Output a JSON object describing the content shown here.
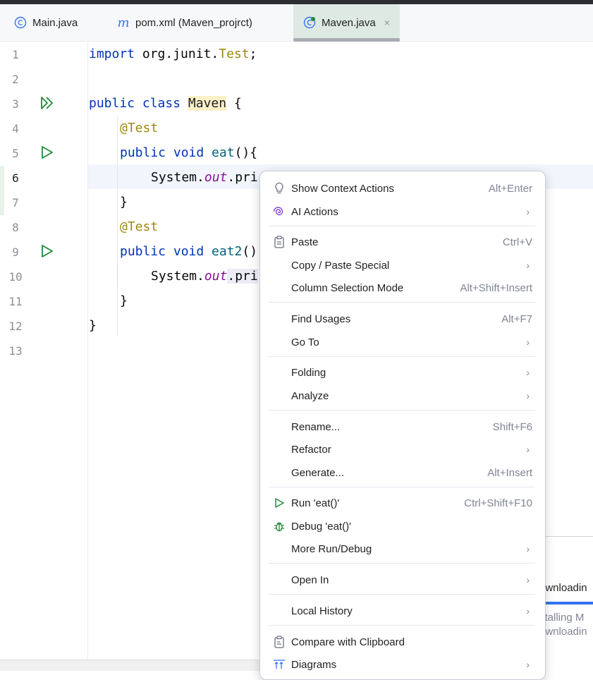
{
  "tabs": [
    {
      "label": "Main.java",
      "icon": "java-class-icon"
    },
    {
      "label": "pom.xml (Maven_projrct)",
      "icon": "maven-icon"
    },
    {
      "label": "Maven.java",
      "icon": "java-test-class-icon",
      "close": "×"
    }
  ],
  "editor": {
    "line_numbers": [
      "1",
      "2",
      "3",
      "4",
      "5",
      "6",
      "7",
      "8",
      "9",
      "10",
      "11",
      "12",
      "13"
    ],
    "code": {
      "l1_kw": "import",
      "l1_pkg": " org.junit.",
      "l1_cls": "Test",
      "l1_end": ";",
      "l3_kw": "public class ",
      "l3_cls": "Maven",
      "l3_end": " {",
      "l4_ann": "@Test",
      "l5_kw": "public void ",
      "l5_m": "eat",
      "l5_end": "(){",
      "l6_a": "System.",
      "l6_f": "out",
      "l6_b": ".pri",
      "l7": "}",
      "l8_ann": "@Test",
      "l9_kw": "public void ",
      "l9_m": "eat2",
      "l9_end": "()",
      "l10_a": "System.",
      "l10_f": "out",
      "l10_b": ".pri",
      "l11": "}",
      "l12": "}"
    }
  },
  "background_popup": {
    "line1": "ownloadin",
    "line2": "stalling M",
    "line3": "ownloadin"
  },
  "context_menu": {
    "items": [
      {
        "label": "Show Context Actions",
        "shortcut": "Alt+Enter",
        "icon": "lightbulb-icon"
      },
      {
        "label": "AI Actions",
        "submenu": "›",
        "icon": "ai-spiral-icon"
      },
      {
        "label": "Paste",
        "shortcut": "Ctrl+V",
        "icon": "clipboard-icon"
      },
      {
        "label": "Copy / Paste Special",
        "submenu": "›"
      },
      {
        "label": "Column Selection Mode",
        "shortcut": "Alt+Shift+Insert"
      },
      {
        "label": "Find Usages",
        "shortcut": "Alt+F7"
      },
      {
        "label": "Go To",
        "submenu": "›"
      },
      {
        "label": "Folding",
        "submenu": "›"
      },
      {
        "label": "Analyze",
        "submenu": "›"
      },
      {
        "label": "Rename...",
        "shortcut": "Shift+F6"
      },
      {
        "label": "Refactor",
        "submenu": "›"
      },
      {
        "label": "Generate...",
        "shortcut": "Alt+Insert"
      },
      {
        "label": "Run 'eat()'",
        "shortcut": "Ctrl+Shift+F10",
        "icon": "run-icon"
      },
      {
        "label": "Debug 'eat()'",
        "icon": "debug-bug-icon"
      },
      {
        "label": "More Run/Debug",
        "submenu": "›"
      },
      {
        "label": "Open In",
        "submenu": "›"
      },
      {
        "label": "Local History",
        "submenu": "›"
      },
      {
        "label": "Compare with Clipboard",
        "icon": "compare-clipboard-icon"
      },
      {
        "label": "Diagrams",
        "submenu": "›",
        "icon": "diagram-icon"
      }
    ]
  },
  "colors": {
    "accent": "#3574f0",
    "run_green": "#208a3c",
    "keyword": "#0033b3",
    "annotation": "#9e880d"
  }
}
